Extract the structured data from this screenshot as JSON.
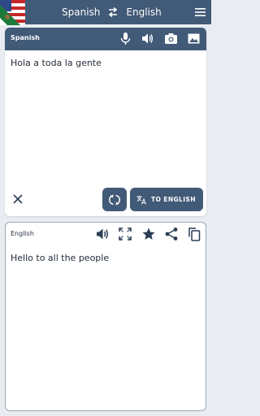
{
  "topbar": {
    "source_language": "Spanish",
    "target_language": "English"
  },
  "source_panel": {
    "language_label": "Spanish",
    "text": "Hola a toda la gente",
    "translate_button_label": "TO ENGLISH"
  },
  "target_panel": {
    "language_label": "English",
    "text": "Hello to all the people"
  },
  "colors": {
    "primary": "#415a77",
    "background": "#e9edf2",
    "card": "#ffffff",
    "text": "#1f2a36",
    "icon_dark": "#2c3e55"
  },
  "icons": {
    "flag": "mexico-usa-flag-icon",
    "swap": "swap-arrows-icon",
    "menu": "hamburger-menu-icon",
    "mic": "microphone-icon",
    "speaker": "speaker-icon",
    "camera": "camera-icon",
    "image": "image-icon",
    "clear": "close-icon",
    "cycle": "cycle-arrows-icon",
    "translate": "translate-icon",
    "fullscreen": "fullscreen-icon",
    "favorite": "star-icon",
    "share": "share-icon",
    "copy": "copy-icon"
  }
}
